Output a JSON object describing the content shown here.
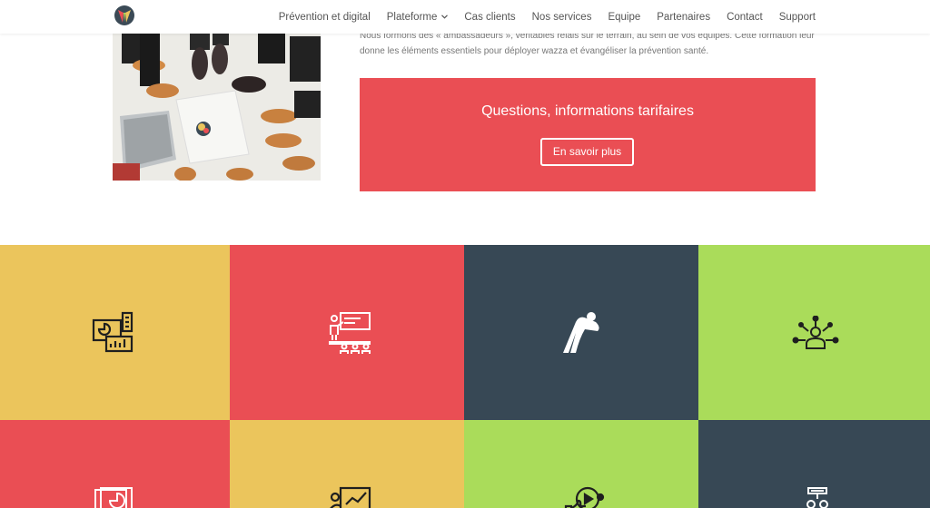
{
  "header": {
    "logo_icon": "colorful-logo",
    "nav": [
      {
        "label": "Prévention et digital"
      },
      {
        "label": "Plateforme",
        "has_dropdown": true
      },
      {
        "label": "Cas clients"
      },
      {
        "label": "Nos services"
      },
      {
        "label": "Equipe"
      },
      {
        "label": "Partenaires"
      },
      {
        "label": "Contact"
      },
      {
        "label": "Support"
      }
    ]
  },
  "intro": {
    "text": "Nous formons des « ambassadeurs », véritables relais sur le terrain, au sein de vos équipes. Cette formation leur donne les éléments essentiels pour déployer wazza et évangéliser la prévention santé."
  },
  "cta": {
    "title": "Questions, informations tarifaires",
    "button_label": "En savoir plus"
  },
  "colors": {
    "yellow": "#ebc55c",
    "red": "#ea4e54",
    "navy": "#374855",
    "green": "#aadc5a"
  },
  "tiles": [
    {
      "icon": "dashboard-analytics-icon",
      "color": "yellow"
    },
    {
      "icon": "presentation-audience-icon",
      "color": "red"
    },
    {
      "icon": "stretching-person-icon",
      "color": "navy"
    },
    {
      "icon": "network-person-icon",
      "color": "green"
    },
    {
      "icon": "documents-chart-icon",
      "color": "red"
    },
    {
      "icon": "presenter-chart-icon",
      "color": "yellow"
    },
    {
      "icon": "video-thumbs-up-icon",
      "color": "green"
    },
    {
      "icon": "team-board-icon",
      "color": "navy"
    }
  ]
}
